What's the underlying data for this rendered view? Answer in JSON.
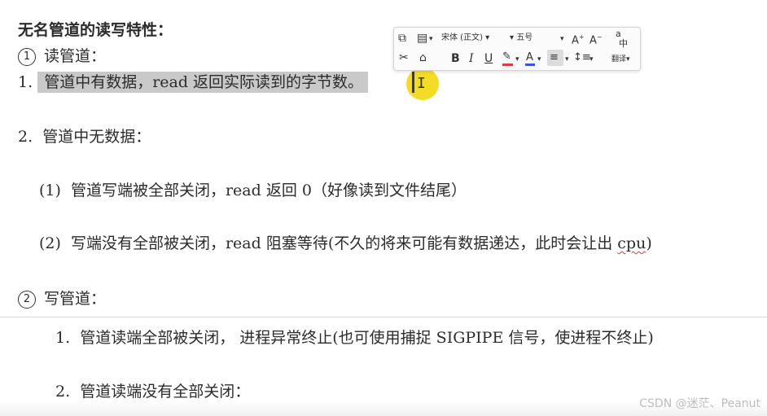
{
  "document": {
    "title": "无名管道的读写特性：",
    "read_pipe": {
      "marker": "1",
      "heading": "读管道：",
      "item1": {
        "num": "1.",
        "text": "管道中有数据，read 返回实际读到的字节数。"
      },
      "item2": {
        "num": "2.",
        "text": "管道中无数据："
      },
      "sub1": {
        "num": "(1)",
        "text": "管道写端被全部关闭，read 返回 0（好像读到文件结尾）"
      },
      "sub2": {
        "num": "(2)",
        "text_before": "写端没有全部被关闭，read 阻塞等待(不久的将来可能有数据递达，此时会让出 ",
        "text_squiggle": "cpu",
        "text_after": ")"
      }
    },
    "write_pipe": {
      "marker": "2",
      "heading": "写管道：",
      "item1": {
        "num": "1.",
        "text": "管道读端全部被关闭， 进程异常终止(也可使用捕捉 SIGPIPE 信号，使进程不终止)"
      },
      "item2": {
        "num": "2.",
        "text": "管道读端没有全部关闭："
      }
    }
  },
  "toolbar": {
    "font_name": "宋体 (正文)",
    "font_size": "五号",
    "grow_font": "A",
    "shrink_font": "A",
    "bold": "B",
    "italic": "I",
    "underline": "U",
    "font_color_letter": "A",
    "translate_label": "翻译",
    "translate_icon_text": "a",
    "translate_icon_text2": "中",
    "highlight_color": "#e23b3b",
    "font_color": "#2e5bd6"
  },
  "watermark": "CSDN @迷茫、Peanut"
}
